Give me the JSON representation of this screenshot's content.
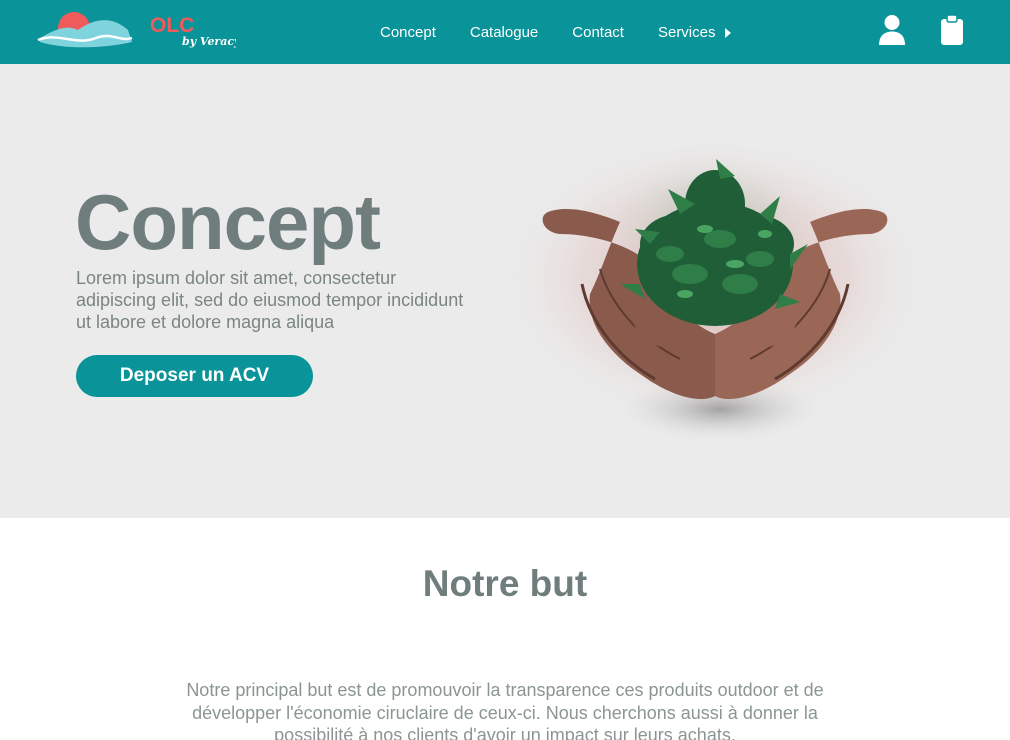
{
  "brand": {
    "logo_text": "OLC",
    "logo_sub": "by Veracy"
  },
  "nav": {
    "items": [
      {
        "label": "Concept"
      },
      {
        "label": "Catalogue"
      },
      {
        "label": "Contact"
      },
      {
        "label": "Services"
      }
    ]
  },
  "header_icons": [
    "user-icon",
    "clipboard-icon",
    "caret-right-icon"
  ],
  "hero": {
    "title": "Concept",
    "text": "Lorem ipsum dolor sit amet, consectetur adipiscing elit, sed do eiusmod tempor incididunt ut labore et dolore magna aliqua",
    "cta_label": "Deposer un ACV"
  },
  "section": {
    "title": "Notre but",
    "text": "Notre principal but est de promouvoir la transparence ces produits outdoor et de développer l'économie ciruclaire de ceux-ci. Nous cherchons aussi à donner la possibilité à nos clients d'avoir un impact sur leurs achats."
  },
  "colors": {
    "header": "#0a9399",
    "accent": "#0a9399",
    "logo_red": "#ef5b5b",
    "hero_bg": "#ebebeb",
    "heading": "#6f7d7c",
    "body_text": "#7a8584"
  }
}
